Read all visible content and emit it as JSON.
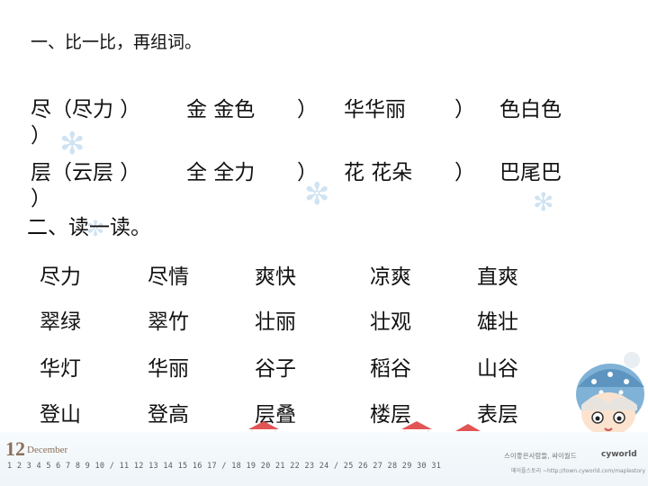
{
  "section1_title": "一、比一比，再组词。",
  "compare": {
    "row1": {
      "c1": "尽（尽力  ）",
      "c1b": "）",
      "c2": "金  金色",
      "c2p": "）",
      "c3": "华华丽",
      "c3p": "）",
      "c4": "色白色"
    },
    "row2": {
      "c1": "层（云层  ）",
      "c1b": "）",
      "c2": "全  全力",
      "c2p": "）",
      "c3": "花 花朵",
      "c3p": "）",
      "c4": "巴尾巴"
    }
  },
  "section2_title": "二、读一读。",
  "reading": [
    [
      "尽力",
      "尽情",
      "爽快",
      "凉爽",
      "直爽"
    ],
    [
      "翠绿",
      "翠竹",
      "壮丽",
      "壮观",
      "雄壮"
    ],
    [
      "华灯",
      "华丽",
      "谷子",
      "稻谷",
      "山谷"
    ],
    [
      "登山",
      "登高",
      "层叠",
      "楼层",
      "表层"
    ]
  ],
  "footer": {
    "month_num": "12",
    "month_name": "December",
    "days": "1 2 3 4 5 6 7 8 9 10 / 11 12 13 14 15 16 17 / 18 19 20 21 22 23 24 / 25 26 27 28 29 30 31",
    "credit_line1": "스이좋은사람들, 싸이월드",
    "brand": "cyworld",
    "credit_line2": "메이플스토리 ~http://town.cyworld.com/maplestory"
  }
}
